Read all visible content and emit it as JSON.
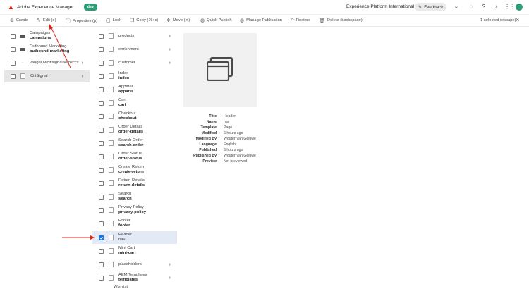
{
  "header": {
    "app_name": "Adobe Experience Manager",
    "env_badge": "dev",
    "org_name": "Experience Platform International",
    "feedback_label": "Feedback"
  },
  "actions": [
    {
      "label": "Create",
      "icon": "plus-circle-icon"
    },
    {
      "label": "Edit (e)",
      "icon": "pencil-icon"
    },
    {
      "label": "Properties (p)",
      "icon": "info-icon"
    },
    {
      "label": "Lock",
      "icon": "lock-icon"
    },
    {
      "label": "Copy (⌘+c)",
      "icon": "copy-icon"
    },
    {
      "label": "Move (m)",
      "icon": "move-icon"
    },
    {
      "label": "Quick Publish",
      "icon": "globe-icon"
    },
    {
      "label": "Manage Publication",
      "icon": "globe-gear-icon"
    },
    {
      "label": "Restore",
      "icon": "restore-icon"
    },
    {
      "label": "Delete (backspace)",
      "icon": "trash-icon"
    }
  ],
  "selection": {
    "info": "1 selected (escape)"
  },
  "column1": [
    {
      "title": "Campaigns",
      "name": "campaigns",
      "type": "folder",
      "has_children": false
    },
    {
      "title": "Outbound Marketing",
      "name": "outbound-marketing",
      "type": "folder",
      "has_children": false
    },
    {
      "title": "vangeluwcitisignalaemsccs",
      "name": "",
      "type": "page",
      "has_children": true
    },
    {
      "title": "CitiSignal",
      "name": "",
      "type": "page",
      "has_children": true
    }
  ],
  "column2": [
    {
      "title": "products",
      "name": "",
      "has_children": true,
      "checked": false
    },
    {
      "title": "enrichment",
      "name": "",
      "has_children": true,
      "checked": false
    },
    {
      "title": "customer",
      "name": "",
      "has_children": true,
      "checked": false
    },
    {
      "title": "Index",
      "name": "index",
      "has_children": false,
      "checked": false
    },
    {
      "title": "Apparel",
      "name": "apparel",
      "has_children": false,
      "checked": false
    },
    {
      "title": "Cart",
      "name": "cart",
      "has_children": false,
      "checked": false
    },
    {
      "title": "Checkout",
      "name": "checkout",
      "has_children": false,
      "checked": false
    },
    {
      "title": "Order Details",
      "name": "order-details",
      "has_children": false,
      "checked": false
    },
    {
      "title": "Search Order",
      "name": "search-order",
      "has_children": false,
      "checked": false
    },
    {
      "title": "Order Status",
      "name": "order-status",
      "has_children": false,
      "checked": false
    },
    {
      "title": "Create Return",
      "name": "create-return",
      "has_children": false,
      "checked": false
    },
    {
      "title": "Return Details",
      "name": "return-details",
      "has_children": false,
      "checked": false
    },
    {
      "title": "Search",
      "name": "search",
      "has_children": false,
      "checked": false
    },
    {
      "title": "Privacy Policy",
      "name": "privacy-policy",
      "has_children": false,
      "checked": false
    },
    {
      "title": "Footer",
      "name": "footer",
      "has_children": false,
      "checked": false
    },
    {
      "title": "Header",
      "name": "nav",
      "has_children": false,
      "checked": true
    },
    {
      "title": "Mini Cart",
      "name": "mini-cart",
      "has_children": false,
      "checked": false
    },
    {
      "title": "placeholders",
      "name": "",
      "has_children": true,
      "checked": false
    },
    {
      "title": "AEM Templates",
      "name": "templates",
      "has_children": true,
      "checked": false
    },
    {
      "title": "Wishlist",
      "name": "",
      "has_children": false,
      "checked": false
    }
  ],
  "properties": [
    {
      "key": "Title",
      "value": "Header"
    },
    {
      "key": "Name",
      "value": "nav"
    },
    {
      "key": "Template",
      "value": "Page"
    },
    {
      "key": "Modified",
      "value": "6 hours ago"
    },
    {
      "key": "Modified By",
      "value": "Wouter Van Geluwe"
    },
    {
      "key": "Language",
      "value": "English"
    },
    {
      "key": "Published",
      "value": "6 hours ago"
    },
    {
      "key": "Published By",
      "value": "Wouter Van Geluwe"
    },
    {
      "key": "Preview",
      "value": "Not previewed"
    }
  ],
  "colors": {
    "accent": "#1473e6",
    "badge": "#2d9d78",
    "annotation": "#e0261b",
    "adobe": "#eb1000"
  }
}
